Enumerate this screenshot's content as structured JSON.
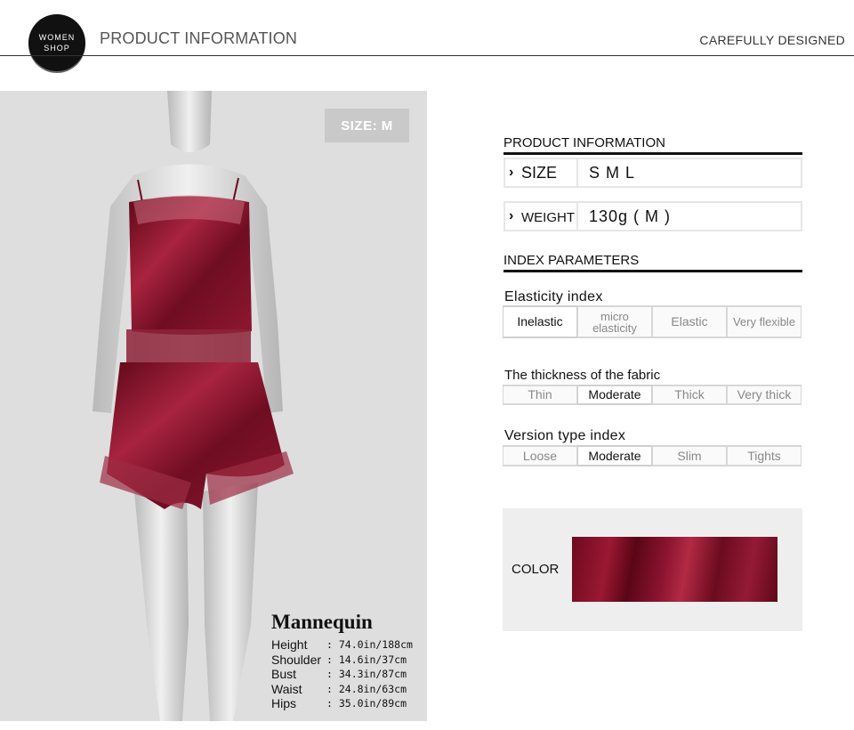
{
  "header": {
    "logo_line1": "WOMEN",
    "logo_line2": "SHOP",
    "title": "PRODUCT INFORMATION",
    "tagline": "CAREFULLY DESIGNED"
  },
  "photo": {
    "size_tag": "SIZE: M",
    "mannequin": {
      "title": "Mannequin",
      "rows": [
        {
          "label": "Height",
          "value": ": 74.0in/188cm"
        },
        {
          "label": "Shoulder",
          "value": ": 14.6in/37cm"
        },
        {
          "label": "Bust",
          "value": ": 34.3in/87cm"
        },
        {
          "label": "Waist",
          "value": ": 24.8in/63cm"
        },
        {
          "label": "Hips",
          "value": ": 35.0in/89cm"
        }
      ]
    }
  },
  "product_info": {
    "title": "PRODUCT INFORMATION",
    "size_label": "SIZE",
    "size_value": "S M L",
    "weight_label": "WEIGHT",
    "weight_value": "130g ( M )"
  },
  "index_params": {
    "title": "INDEX PARAMETERS",
    "elasticity": {
      "label": "Elasticity index",
      "options": [
        "Inelastic",
        "micro elasticity",
        "Elastic",
        "Very flexible"
      ],
      "selected": "Inelastic"
    },
    "thickness": {
      "label": "The thickness of the fabric",
      "options": [
        "Thin",
        "Moderate",
        "Thick",
        "Very thick"
      ],
      "selected": "Moderate"
    },
    "version": {
      "label": "Version type index",
      "options": [
        "Loose",
        "Moderate",
        "Slim",
        "Tights"
      ],
      "selected": "Moderate"
    }
  },
  "color": {
    "label": "COLOR",
    "swatch_hex": "#8c1430"
  },
  "colors": {
    "garment": "#7a0f25",
    "accent_rule": "#111111"
  }
}
